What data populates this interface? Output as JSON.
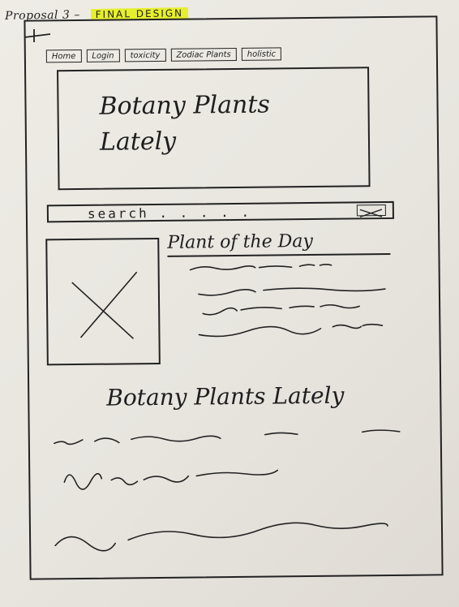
{
  "header": {
    "proposal_label": "Proposal 3 –",
    "design_label": "FINAL DESIGN"
  },
  "nav": {
    "items": [
      {
        "label": "Home"
      },
      {
        "label": "Login"
      },
      {
        "label": "toxicity"
      },
      {
        "label": "Zodiac Plants"
      },
      {
        "label": "holistic"
      }
    ]
  },
  "hero": {
    "title": "Botany Plants Lately"
  },
  "search": {
    "placeholder": "search . . . . ."
  },
  "plant_of_the_day": {
    "title": "Plant of the Day"
  },
  "section": {
    "title": "Botany Plants Lately"
  },
  "colors": {
    "highlight": "#e6ef2d",
    "ink": "#222222",
    "paper": "#ece9e3"
  },
  "icons": {
    "image_placeholder": "x-placeholder-icon",
    "search_button": "x-icon"
  }
}
